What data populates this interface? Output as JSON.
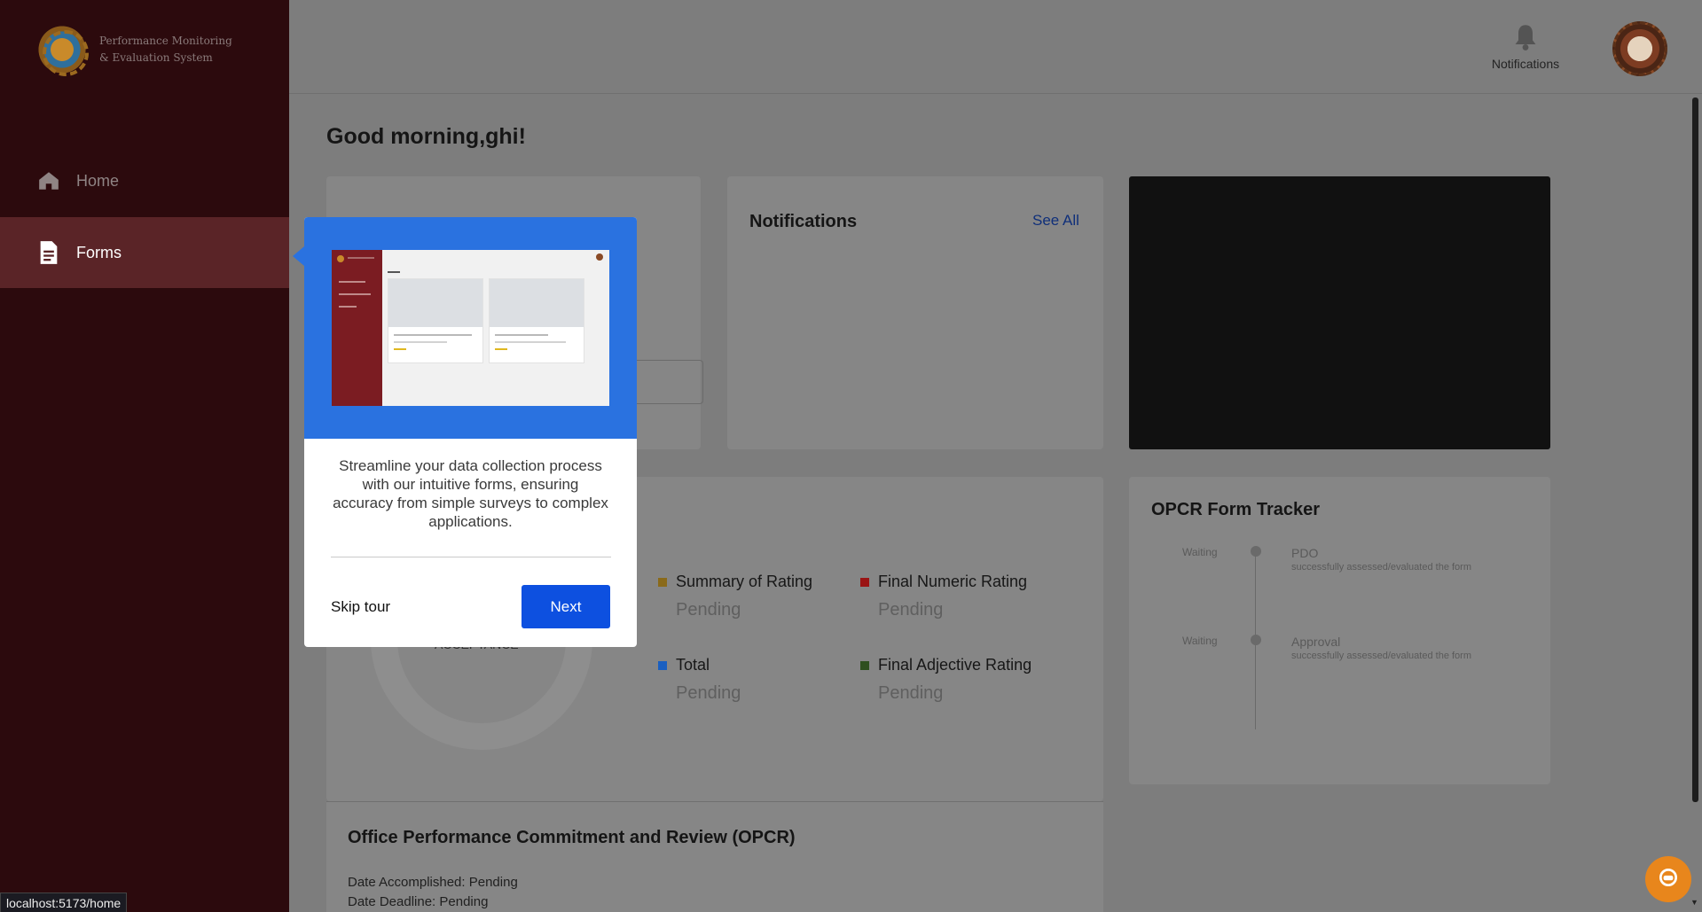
{
  "app": {
    "logo_text": "Performance Monitoring & Evaluation System"
  },
  "sidebar": {
    "items": [
      {
        "label": "Home",
        "icon": "home-icon",
        "active": false
      },
      {
        "label": "Forms",
        "icon": "document-icon",
        "active": true
      }
    ]
  },
  "header": {
    "notifications_label": "Notifications"
  },
  "main": {
    "greeting": "Good morning,ghi!",
    "notifications_card": {
      "title": "Notifications",
      "see_all": "See All"
    },
    "rating": {
      "donut_label": "ACCEPTANCE",
      "items": [
        {
          "label": "Summary of Rating",
          "value": "Pending",
          "color": "#8a6a1a"
        },
        {
          "label": "Final Numeric Rating",
          "value": "Pending",
          "color": "#9a1414"
        },
        {
          "label": "Total",
          "value": "Pending",
          "color": "#1a5fc0"
        },
        {
          "label": "Final Adjective Rating",
          "value": "Pending",
          "color": "#2f4f1f"
        }
      ]
    },
    "tracker": {
      "title": "OPCR Form Tracker",
      "steps": [
        {
          "status": "Waiting",
          "title": "PDO",
          "desc": "successfully assessed/evaluated the form"
        },
        {
          "status": "Waiting",
          "title": "Approval",
          "desc": "successfully assessed/evaluated the form"
        }
      ]
    },
    "opcr": {
      "title": "Office Performance Commitment and Review (OPCR)",
      "date_accomplished": "Date Accomplished: Pending",
      "date_deadline": "Date Deadline: Pending"
    }
  },
  "tour": {
    "description": "Streamline your data collection process with our intuitive forms, ensuring accuracy from simple surveys to complex applications.",
    "skip_label": "Skip tour",
    "next_label": "Next"
  },
  "status_bar": {
    "url": "localhost:5173/home"
  }
}
